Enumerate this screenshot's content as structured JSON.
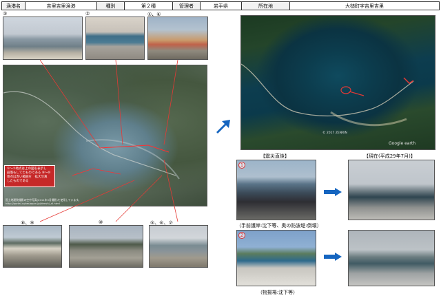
{
  "header": {
    "port_label": "漁港名",
    "port_value": "吉里吉里漁港",
    "class_label": "種別",
    "class_value": "第２種",
    "manager_label": "管理者",
    "manager_value": "岩手県",
    "location_label": "所在地",
    "location_value": "大槌町字吉里吉里"
  },
  "photos": {
    "p3": {
      "label": "③"
    },
    "p2": {
      "label": "②"
    },
    "p14": {
      "label": "①、④"
    },
    "p89": {
      "label": "⑧、⑨"
    },
    "p10": {
      "label": "⑩"
    },
    "p567": {
      "label": "⑤、⑥、⑦"
    }
  },
  "aerial_note": {
    "text": "①～⑦地点は上の図を表示し　　　　崩落もしてたものである ⑧～⑩地点は赤い範囲を　拡大写真　　　　したものである",
    "credit": "国土地理院撮影の空中写真(2011年3月撮影)を使用しています。 http://portal.cyberjapan.jp/denshi_dl.html"
  },
  "satellite": {
    "logo": "Google earth",
    "copyright": "© 2017 ZENRIN"
  },
  "captions": {
    "after_quake": "【震災直後】",
    "present": "【現在(平成29年7月)】",
    "seawall": "（手前護岸:沈下等、奥の防波堤:倒壊）",
    "yard": "（物揚場:沈下等）"
  },
  "markers": {
    "m1": "1",
    "m2": "2"
  },
  "colors": {
    "accent_red": "#d32f2f",
    "arrow_blue": "#1565c0"
  }
}
